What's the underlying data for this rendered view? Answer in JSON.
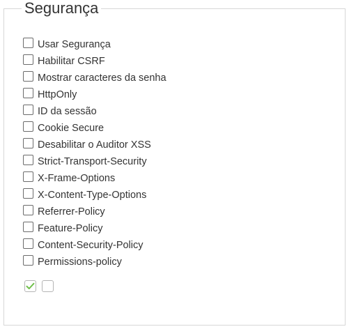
{
  "section": {
    "title": "Segurança"
  },
  "options": [
    {
      "label": "Usar Segurança",
      "checked": false
    },
    {
      "label": "Habilitar CSRF",
      "checked": false
    },
    {
      "label": "Mostrar caracteres da senha",
      "checked": false
    },
    {
      "label": "HttpOnly",
      "checked": false
    },
    {
      "label": "ID da sessão",
      "checked": false
    },
    {
      "label": "Cookie Secure",
      "checked": false
    },
    {
      "label": "Desabilitar o Auditor XSS",
      "checked": false
    },
    {
      "label": "Strict-Transport-Security",
      "checked": false
    },
    {
      "label": "X-Frame-Options",
      "checked": false
    },
    {
      "label": "X-Content-Type-Options",
      "checked": false
    },
    {
      "label": "Referrer-Policy",
      "checked": false
    },
    {
      "label": "Feature-Policy",
      "checked": false
    },
    {
      "label": "Content-Security-Policy",
      "checked": false
    },
    {
      "label": "Permissions-policy",
      "checked": false
    }
  ],
  "actions": {
    "confirm_icon": "checkmark-icon",
    "confirm_color": "#6fbf4a",
    "cancel_icon": "empty-box-icon"
  }
}
